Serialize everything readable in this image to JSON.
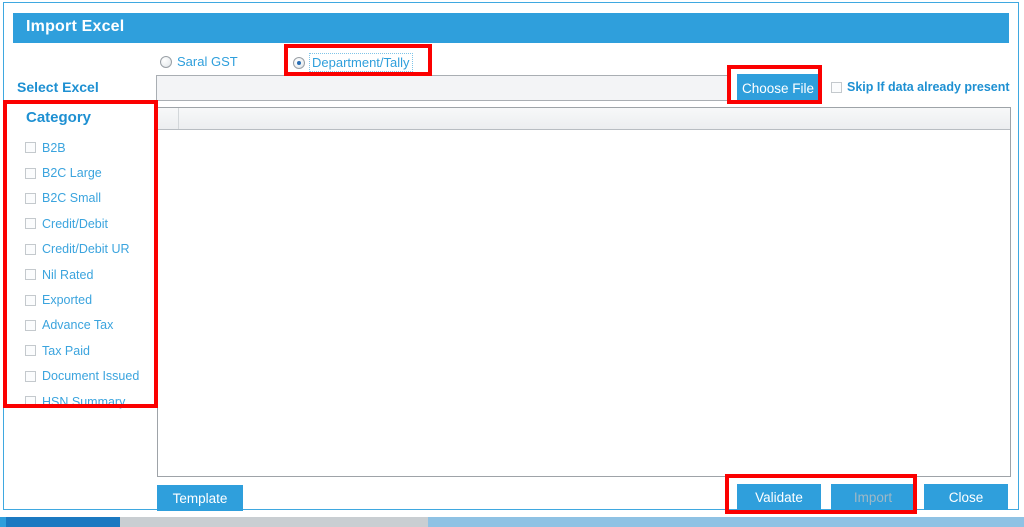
{
  "window": {
    "title": "Import Excel"
  },
  "source_options": {
    "saral": {
      "label": "Saral GST",
      "selected": false
    },
    "department": {
      "label": "Department/Tally",
      "selected": true
    }
  },
  "select_excel": {
    "label": "Select Excel",
    "file_path_value": "",
    "file_path_placeholder": "",
    "choose_file_label": "Choose File",
    "skip_label": "Skip If data already present",
    "skip_checked": false
  },
  "category": {
    "title": "Category",
    "items": [
      {
        "label": "B2B",
        "checked": false
      },
      {
        "label": "B2C Large",
        "checked": false
      },
      {
        "label": "B2C Small",
        "checked": false
      },
      {
        "label": "Credit/Debit",
        "checked": false
      },
      {
        "label": "Credit/Debit UR",
        "checked": false
      },
      {
        "label": "Nil Rated",
        "checked": false
      },
      {
        "label": "Exported",
        "checked": false
      },
      {
        "label": "Advance Tax",
        "checked": false
      },
      {
        "label": "Tax Paid",
        "checked": false
      },
      {
        "label": "Document Issued",
        "checked": false
      },
      {
        "label": "HSN Summary",
        "checked": false
      }
    ]
  },
  "grid": {
    "columns": [],
    "rows": []
  },
  "footer": {
    "template_label": "Template",
    "validate_label": "Validate",
    "import_label": "Import",
    "import_disabled": true,
    "close_label": "Close"
  },
  "colors": {
    "accent": "#2f9fdc",
    "link_text": "#3ba4de",
    "heading": "#1e90d2",
    "annotation": "#fb0000",
    "disabled_text": "#9fb8c6"
  }
}
